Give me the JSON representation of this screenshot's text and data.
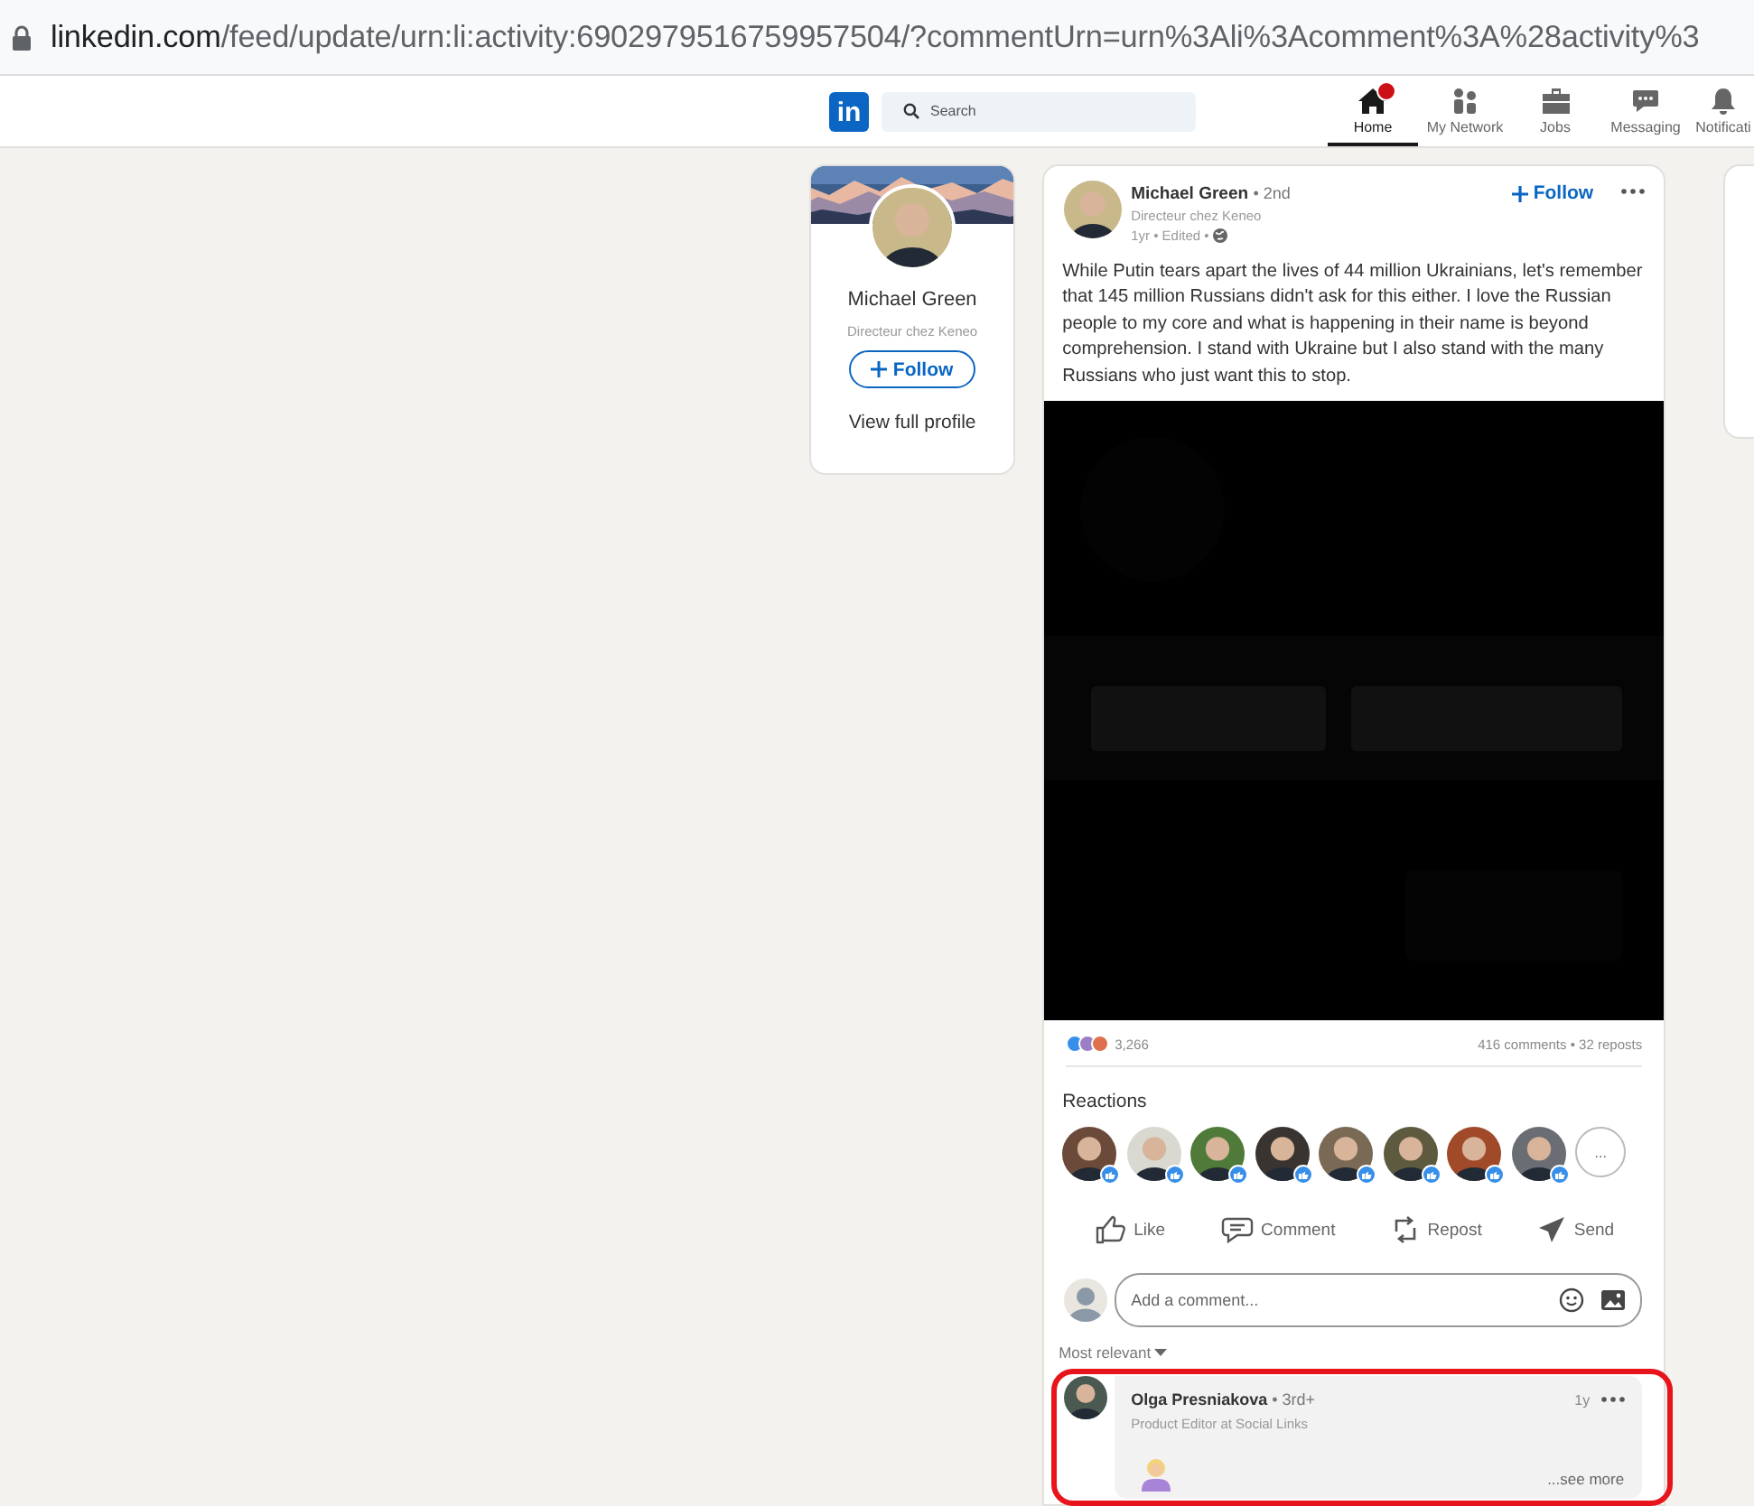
{
  "browser": {
    "url_domain": "linkedin.com",
    "url_path": "/feed/update/urn:li:activity:6902979516759957504/?commentUrn=urn%3Ali%3Acomment%3A%28activity%3"
  },
  "nav": {
    "logo": "in",
    "search": {
      "placeholder": "Search"
    },
    "items": [
      {
        "label": "Home",
        "selected": true,
        "badge": true
      },
      {
        "label": "My Network",
        "selected": false,
        "badge": false
      },
      {
        "label": "Jobs",
        "selected": false,
        "badge": false
      },
      {
        "label": "Messaging",
        "selected": false,
        "badge": false
      },
      {
        "label": "Notificati",
        "selected": false,
        "badge": false
      }
    ]
  },
  "profile_card": {
    "name": "Michael Green",
    "headline": "Directeur chez Keneo",
    "follow": "Follow",
    "view_profile": "View full profile"
  },
  "post": {
    "author": "Michael Green",
    "degree": "• 2nd",
    "headline": "Directeur chez Keneo",
    "meta": "1yr • Edited •",
    "follow": "Follow",
    "text": "While Putin tears apart the lives of 44 million Ukrainians, let's remember that 145 million Russians didn't ask for this either. I love the Russian people to my core and what is happening in their name is beyond comprehension. I stand with Ukraine but I also stand with the many Russians who just want this to stop.",
    "reaction_count": "3,266",
    "comments_reposts": "416 comments • 32 reposts",
    "reactions_title": "Reactions",
    "more_reactors": "...",
    "actions": [
      {
        "label": "Like"
      },
      {
        "label": "Comment"
      },
      {
        "label": "Repost"
      },
      {
        "label": "Send"
      }
    ],
    "comment_box": {
      "placeholder": "Add a comment..."
    },
    "sort": "Most relevant",
    "comments": [
      {
        "author": "Olga Presniakova",
        "degree": "• 3rd+",
        "headline": "Product Editor at Social Links",
        "time": "1y",
        "see_more": "...see more",
        "highlighted": true
      }
    ]
  }
}
